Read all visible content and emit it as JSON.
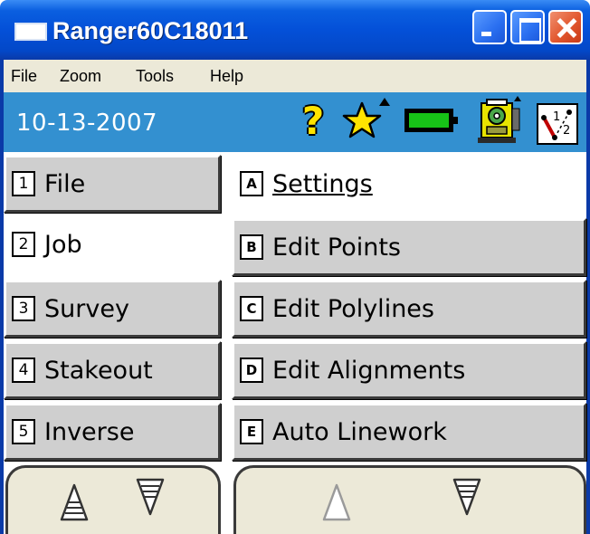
{
  "window": {
    "title": "Ranger60C18011",
    "controls": [
      "minimize",
      "maximize",
      "close"
    ]
  },
  "menu": {
    "items": [
      {
        "label": "File"
      },
      {
        "label": "Zoom"
      },
      {
        "label": "Tools"
      },
      {
        "label": "Help"
      }
    ]
  },
  "status": {
    "date": "10-13-2007",
    "icons": [
      "help-icon",
      "favorites-star-icon",
      "battery-icon",
      "instrument-icon",
      "cogo-icon"
    ],
    "help_glyph": "?",
    "cogo_labels": [
      "1",
      "2"
    ]
  },
  "categories": [
    {
      "key": "1",
      "label": "File",
      "selected": false
    },
    {
      "key": "2",
      "label": "Job",
      "selected": true
    },
    {
      "key": "3",
      "label": "Survey",
      "selected": false
    },
    {
      "key": "4",
      "label": "Stakeout",
      "selected": false
    },
    {
      "key": "5",
      "label": "Inverse",
      "selected": false
    }
  ],
  "options": [
    {
      "key": "A",
      "label": "Settings",
      "selected": true
    },
    {
      "key": "B",
      "label": "Edit Points",
      "selected": false
    },
    {
      "key": "C",
      "label": "Edit Polylines",
      "selected": false
    },
    {
      "key": "D",
      "label": "Edit Alignments",
      "selected": false
    },
    {
      "key": "E",
      "label": "Auto Linework",
      "selected": false
    }
  ],
  "scroll": {
    "left": {
      "up_enabled": true,
      "down_enabled": true
    },
    "right": {
      "up_enabled": false,
      "down_enabled": true
    }
  },
  "colors": {
    "titlebar": "#0450d8",
    "statusbar": "#3390d0",
    "button_face": "#cfcfcf",
    "battery_level": "#17c317",
    "help_glyph": "#ffe400"
  }
}
